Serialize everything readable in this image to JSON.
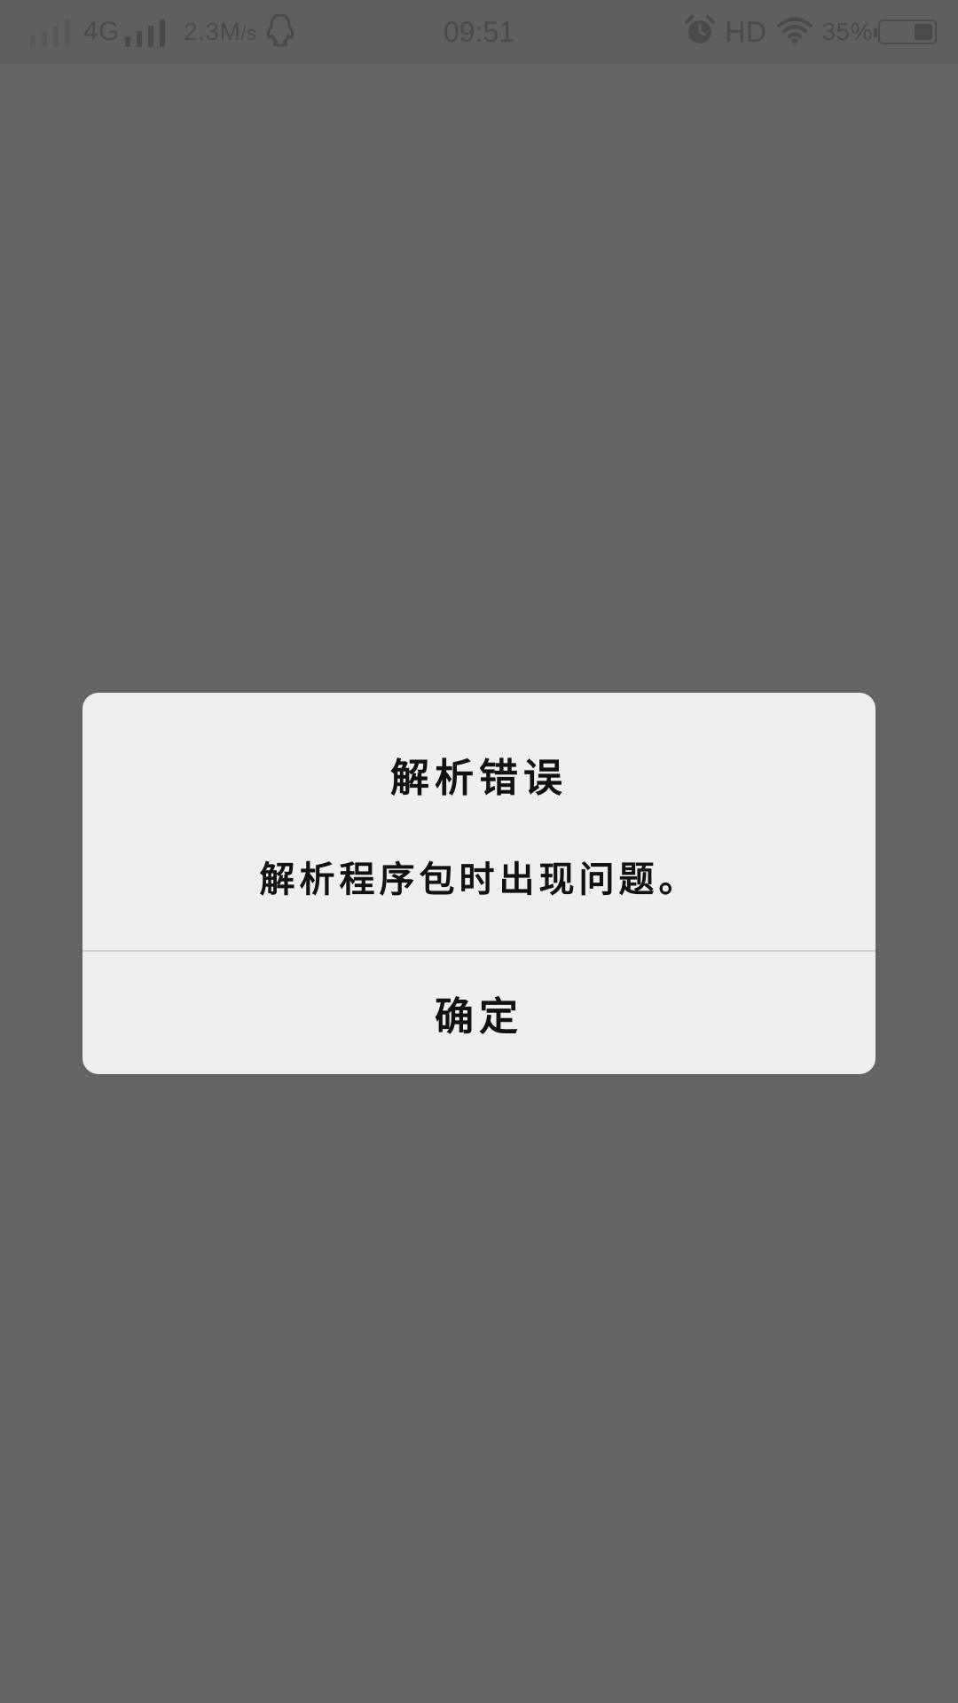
{
  "status_bar": {
    "network_type": "4G",
    "speed_value": "2.3M",
    "speed_unit": "/s",
    "time": "09:51",
    "hd_label": "HD",
    "battery_percent_text": "35%",
    "battery_level": 0.35,
    "icons": [
      "signal-icon-sim1",
      "signal-icon-sim2",
      "qq-icon",
      "alarm-icon",
      "wifi-icon",
      "battery-icon"
    ]
  },
  "dialog": {
    "title": "解析错误",
    "message": "解析程序包时出现问题。",
    "confirm_label": "确定"
  },
  "colors": {
    "scrim": "#646464",
    "dialog_bg": "#efefef",
    "text": "#111111",
    "status_icons": "#4a4a4a"
  }
}
